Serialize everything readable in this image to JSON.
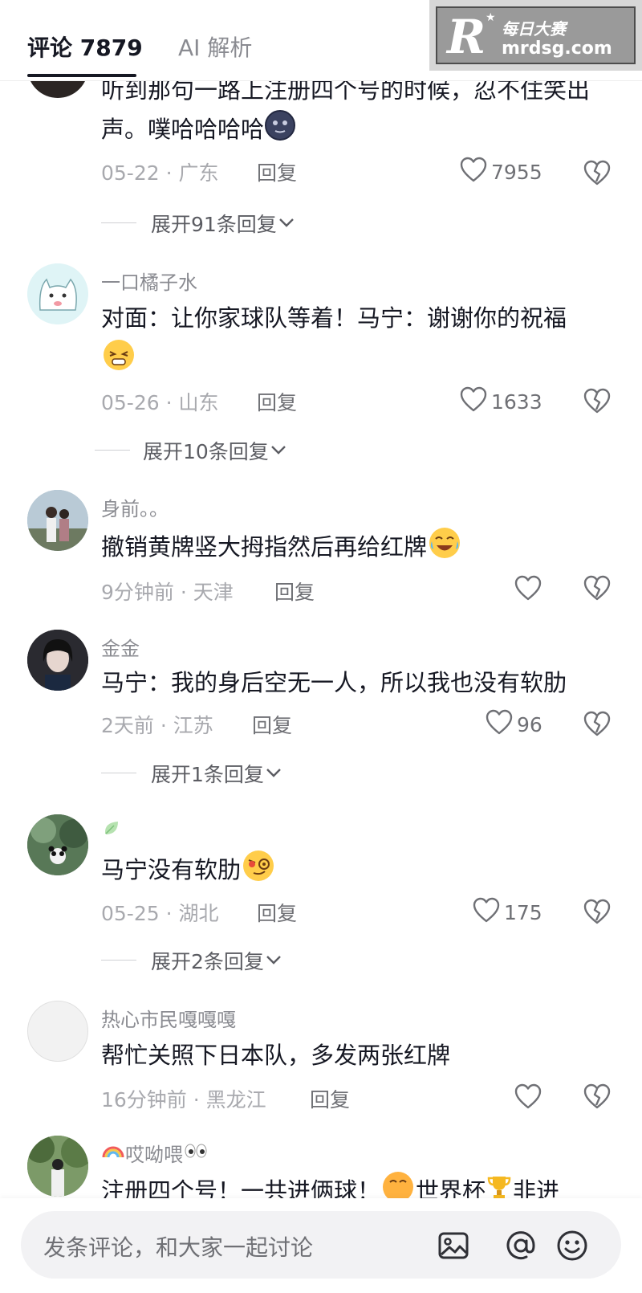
{
  "header": {
    "tab_comments": "评论 7879",
    "tab_ai": "AI 解析",
    "watermark_cn": "每日大赛",
    "watermark_en": "mrdsg.com",
    "watermark_letter": "R"
  },
  "comments": [
    {
      "username": "",
      "text": "听到那句一路上注册四个号的时候，忍不住笑出声。噗哈哈哈哈",
      "text_emoji": "dark-moon-face-emoji",
      "date": "05-22 · 广东",
      "reply": "回复",
      "likes": "7955",
      "expand": "展开91条回复"
    },
    {
      "username": "一口橘子水",
      "text": "对面：让你家球队等着！马宁：谢谢你的祝福",
      "text_emoji": "squinting-grimace-emoji",
      "date": "05-26 · 山东",
      "reply": "回复",
      "likes": "1633",
      "expand": "展开10条回复"
    },
    {
      "username": "身前。。",
      "text": "撤销黄牌竖大拇指然后再给红牌",
      "text_emoji": "laughing-tears-emoji",
      "date": "9分钟前 · 天津",
      "reply": "回复",
      "likes": ""
    },
    {
      "username": "金金",
      "text": "马宁：我的身后空无一人，所以我也没有软肋",
      "date": "2天前 · 江苏",
      "reply": "回复",
      "likes": "96",
      "expand": "展开1条回复"
    },
    {
      "username": "",
      "username_icon": "leaf-icon",
      "text": "马宁没有软肋",
      "text_emoji": "smug-face-emoji",
      "date": "05-25 · 湖北",
      "reply": "回复",
      "likes": "175",
      "expand": "展开2条回复"
    },
    {
      "username": "热心市民嘎嘎嘎",
      "text": "帮忙关照下日本队，多发两张红牌",
      "date": "16分钟前 · 黑龙江",
      "reply": "回复",
      "likes": ""
    },
    {
      "username": "哎呦喂",
      "username_prefix_icon": "rainbow-icon",
      "username_suffix_icon": "eyes-icon",
      "text_a": "注册四个号！一共进俩球！",
      "text_b": "世界杯",
      "text_c": "非进"
    }
  ],
  "bottom": {
    "placeholder": "发条评论，和大家一起讨论"
  },
  "colors": {
    "text_primary": "#161823",
    "text_secondary": "#8a8b91",
    "meta": "#a8a9ae",
    "input_bg": "#f2f2f4"
  }
}
